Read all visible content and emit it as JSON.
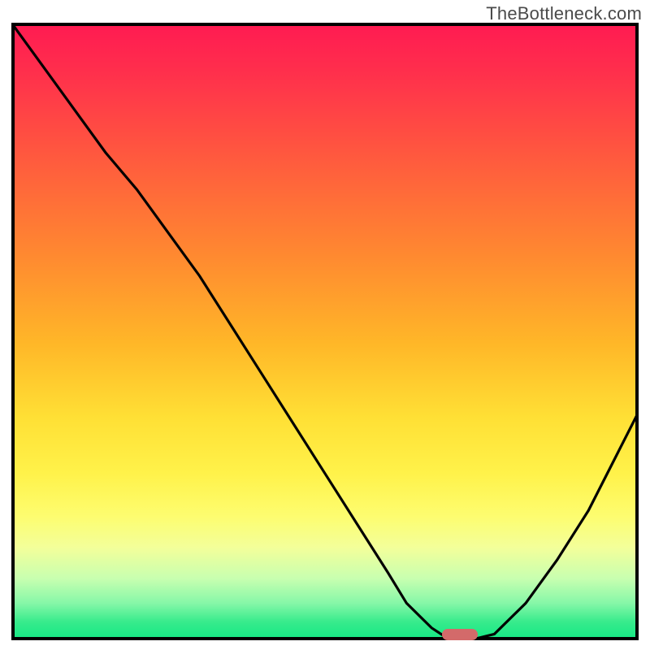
{
  "watermark": "TheBottleneck.com",
  "chart_data": {
    "type": "line",
    "title": "",
    "xlabel": "",
    "ylabel": "",
    "xlim": [
      0,
      1
    ],
    "ylim": [
      0,
      1
    ],
    "x": [
      0.0,
      0.05,
      0.1,
      0.15,
      0.2,
      0.25,
      0.3,
      0.35,
      0.4,
      0.45,
      0.5,
      0.55,
      0.6,
      0.63,
      0.67,
      0.7,
      0.73,
      0.77,
      0.82,
      0.87,
      0.92,
      0.96,
      1.0
    ],
    "values": [
      1.0,
      0.93,
      0.86,
      0.79,
      0.73,
      0.66,
      0.59,
      0.51,
      0.43,
      0.35,
      0.27,
      0.19,
      0.11,
      0.06,
      0.02,
      0.0,
      0.0,
      0.01,
      0.06,
      0.13,
      0.21,
      0.29,
      0.37
    ],
    "marker": {
      "x": 0.715,
      "y": 0.0,
      "color": "#d36a6a",
      "width_frac": 0.056
    },
    "inflection_note": "Slope steepens noticeably around x≈0.25 (visual kink before the sharp descent).",
    "grid": false,
    "legend": null
  },
  "colors": {
    "curve": "#000000",
    "border": "#000000",
    "marker": "#d36a6a"
  }
}
